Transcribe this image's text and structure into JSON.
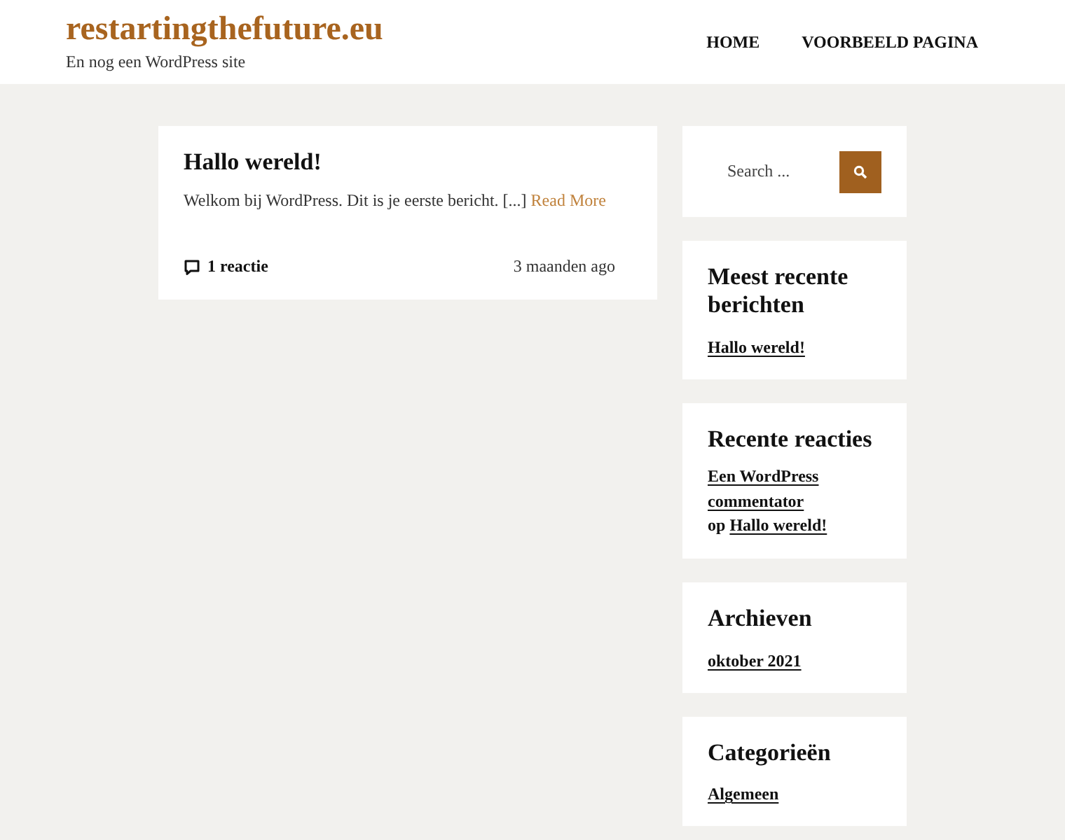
{
  "site": {
    "title": "restartingthefuture.eu",
    "tagline": "En nog een WordPress site"
  },
  "nav": [
    {
      "label": "HOME"
    },
    {
      "label": "VOORBEELD PAGINA"
    }
  ],
  "post": {
    "title": "Hallo wereld!",
    "excerpt": "Welkom bij WordPress. Dit is je eerste bericht. [...]",
    "read_more": "Read More",
    "comments": "1 reactie",
    "date": "3 maanden ago"
  },
  "search": {
    "placeholder": "Search ..."
  },
  "widgets": [
    {
      "kind": "links",
      "title": "Meest recente berichten",
      "links": [
        "Hallo wereld!"
      ]
    },
    {
      "kind": "comment",
      "title": "Recente reacties",
      "author": "Een WordPress commentator",
      "connector": "op",
      "post": "Hallo wereld!"
    },
    {
      "kind": "links",
      "title": "Archieven",
      "links": [
        "oktober 2021"
      ]
    },
    {
      "kind": "links",
      "title": "Categorieën",
      "links": [
        "Algemeen"
      ]
    }
  ]
}
